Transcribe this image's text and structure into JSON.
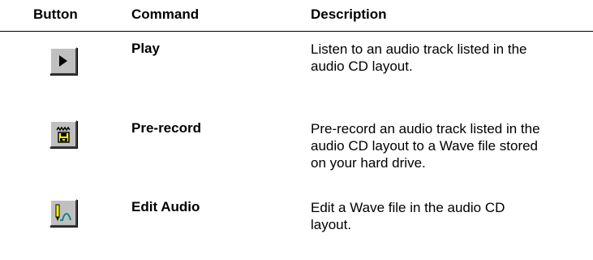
{
  "table": {
    "headers": {
      "button": "Button",
      "command": "Command",
      "description": "Description"
    },
    "rows": [
      {
        "icon": "play-icon",
        "command": "Play",
        "description_lines": [
          "Listen to an audio track listed in the",
          "audio CD layout."
        ]
      },
      {
        "icon": "pre-record-icon",
        "command": "Pre-record",
        "description_lines": [
          "Pre-record an audio track listed in the",
          "audio CD layout to a Wave file stored",
          "on your hard drive."
        ]
      },
      {
        "icon": "edit-audio-icon",
        "command": "Edit Audio",
        "description_lines": [
          "Edit a Wave file in the audio CD",
          "layout."
        ]
      }
    ]
  },
  "colors": {
    "button_face": "#c0c0c0",
    "icon_yellow": "#ffff00",
    "icon_teal": "#008080"
  }
}
